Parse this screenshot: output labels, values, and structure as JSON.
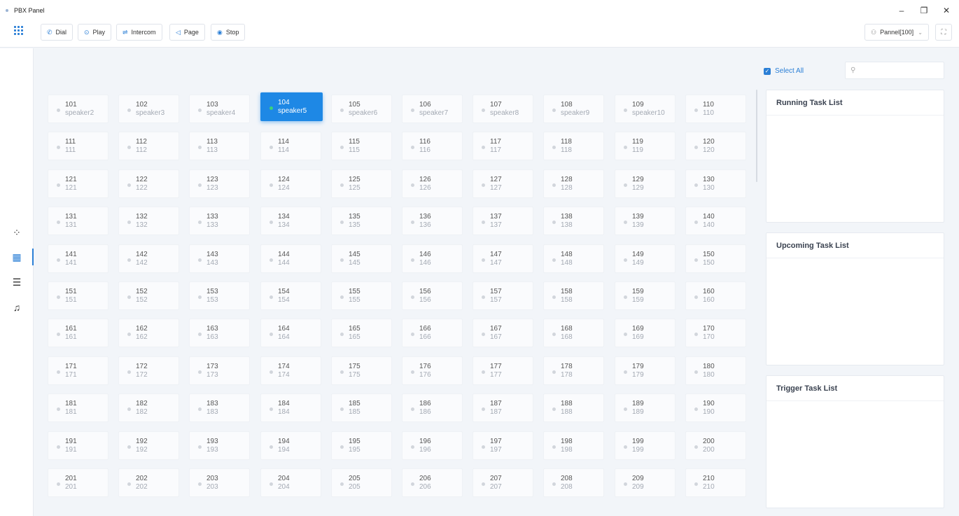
{
  "app": {
    "title": "PBX Panel"
  },
  "window": {
    "minimize": "–",
    "restore": "❐",
    "close": "✕"
  },
  "toolbar": {
    "buttons": [
      {
        "label": "Dial",
        "icon": "phone-icon",
        "glyph": "✆"
      },
      {
        "label": "Play",
        "icon": "play-icon",
        "glyph": "⊙"
      },
      {
        "label": "Intercom",
        "icon": "intercom-icon",
        "glyph": "⇌"
      },
      {
        "label": "Page",
        "icon": "megaphone-icon",
        "glyph": "◁"
      },
      {
        "label": "Stop",
        "icon": "stop-icon",
        "glyph": "◉"
      }
    ],
    "user": "Pannel[100]"
  },
  "sidenav": [
    {
      "name": "dashboard",
      "icon": "apps-grid-icon",
      "glyph": "⁘"
    },
    {
      "name": "panel",
      "icon": "panel-icon",
      "glyph": "▦",
      "active": true
    },
    {
      "name": "list",
      "icon": "list-icon",
      "glyph": "☰"
    },
    {
      "name": "music",
      "icon": "music-icon",
      "glyph": "♫"
    }
  ],
  "right": {
    "select_all": "Select All",
    "search_placeholder": "",
    "panels": [
      "Running Task List",
      "Upcoming Task List",
      "Trigger Task List"
    ]
  },
  "devices": [
    {
      "n": "101",
      "s": "speaker2"
    },
    {
      "n": "102",
      "s": "speaker3"
    },
    {
      "n": "103",
      "s": "speaker4"
    },
    {
      "n": "104",
      "s": "speaker5",
      "active": true
    },
    {
      "n": "105",
      "s": "speaker6"
    },
    {
      "n": "106",
      "s": "speaker7"
    },
    {
      "n": "107",
      "s": "speaker8"
    },
    {
      "n": "108",
      "s": "speaker9"
    },
    {
      "n": "109",
      "s": "speaker10"
    },
    {
      "n": "110",
      "s": "110"
    },
    {
      "n": "111",
      "s": "111"
    },
    {
      "n": "112",
      "s": "112"
    },
    {
      "n": "113",
      "s": "113"
    },
    {
      "n": "114",
      "s": "114"
    },
    {
      "n": "115",
      "s": "115"
    },
    {
      "n": "116",
      "s": "116"
    },
    {
      "n": "117",
      "s": "117"
    },
    {
      "n": "118",
      "s": "118"
    },
    {
      "n": "119",
      "s": "119"
    },
    {
      "n": "120",
      "s": "120"
    },
    {
      "n": "121",
      "s": "121"
    },
    {
      "n": "122",
      "s": "122"
    },
    {
      "n": "123",
      "s": "123"
    },
    {
      "n": "124",
      "s": "124"
    },
    {
      "n": "125",
      "s": "125"
    },
    {
      "n": "126",
      "s": "126"
    },
    {
      "n": "127",
      "s": "127"
    },
    {
      "n": "128",
      "s": "128"
    },
    {
      "n": "129",
      "s": "129"
    },
    {
      "n": "130",
      "s": "130"
    },
    {
      "n": "131",
      "s": "131"
    },
    {
      "n": "132",
      "s": "132"
    },
    {
      "n": "133",
      "s": "133"
    },
    {
      "n": "134",
      "s": "134"
    },
    {
      "n": "135",
      "s": "135"
    },
    {
      "n": "136",
      "s": "136"
    },
    {
      "n": "137",
      "s": "137"
    },
    {
      "n": "138",
      "s": "138"
    },
    {
      "n": "139",
      "s": "139"
    },
    {
      "n": "140",
      "s": "140"
    },
    {
      "n": "141",
      "s": "141"
    },
    {
      "n": "142",
      "s": "142"
    },
    {
      "n": "143",
      "s": "143"
    },
    {
      "n": "144",
      "s": "144"
    },
    {
      "n": "145",
      "s": "145"
    },
    {
      "n": "146",
      "s": "146"
    },
    {
      "n": "147",
      "s": "147"
    },
    {
      "n": "148",
      "s": "148"
    },
    {
      "n": "149",
      "s": "149"
    },
    {
      "n": "150",
      "s": "150"
    },
    {
      "n": "151",
      "s": "151"
    },
    {
      "n": "152",
      "s": "152"
    },
    {
      "n": "153",
      "s": "153"
    },
    {
      "n": "154",
      "s": "154"
    },
    {
      "n": "155",
      "s": "155"
    },
    {
      "n": "156",
      "s": "156"
    },
    {
      "n": "157",
      "s": "157"
    },
    {
      "n": "158",
      "s": "158"
    },
    {
      "n": "159",
      "s": "159"
    },
    {
      "n": "160",
      "s": "160"
    },
    {
      "n": "161",
      "s": "161"
    },
    {
      "n": "162",
      "s": "162"
    },
    {
      "n": "163",
      "s": "163"
    },
    {
      "n": "164",
      "s": "164"
    },
    {
      "n": "165",
      "s": "165"
    },
    {
      "n": "166",
      "s": "166"
    },
    {
      "n": "167",
      "s": "167"
    },
    {
      "n": "168",
      "s": "168"
    },
    {
      "n": "169",
      "s": "169"
    },
    {
      "n": "170",
      "s": "170"
    },
    {
      "n": "171",
      "s": "171"
    },
    {
      "n": "172",
      "s": "172"
    },
    {
      "n": "173",
      "s": "173"
    },
    {
      "n": "174",
      "s": "174"
    },
    {
      "n": "175",
      "s": "175"
    },
    {
      "n": "176",
      "s": "176"
    },
    {
      "n": "177",
      "s": "177"
    },
    {
      "n": "178",
      "s": "178"
    },
    {
      "n": "179",
      "s": "179"
    },
    {
      "n": "180",
      "s": "180"
    },
    {
      "n": "181",
      "s": "181"
    },
    {
      "n": "182",
      "s": "182"
    },
    {
      "n": "183",
      "s": "183"
    },
    {
      "n": "184",
      "s": "184"
    },
    {
      "n": "185",
      "s": "185"
    },
    {
      "n": "186",
      "s": "186"
    },
    {
      "n": "187",
      "s": "187"
    },
    {
      "n": "188",
      "s": "188"
    },
    {
      "n": "189",
      "s": "189"
    },
    {
      "n": "190",
      "s": "190"
    },
    {
      "n": "191",
      "s": "191"
    },
    {
      "n": "192",
      "s": "192"
    },
    {
      "n": "193",
      "s": "193"
    },
    {
      "n": "194",
      "s": "194"
    },
    {
      "n": "195",
      "s": "195"
    },
    {
      "n": "196",
      "s": "196"
    },
    {
      "n": "197",
      "s": "197"
    },
    {
      "n": "198",
      "s": "198"
    },
    {
      "n": "199",
      "s": "199"
    },
    {
      "n": "200",
      "s": "200"
    },
    {
      "n": "201",
      "s": "201"
    },
    {
      "n": "202",
      "s": "202"
    },
    {
      "n": "203",
      "s": "203"
    },
    {
      "n": "204",
      "s": "204"
    },
    {
      "n": "205",
      "s": "205"
    },
    {
      "n": "206",
      "s": "206"
    },
    {
      "n": "207",
      "s": "207"
    },
    {
      "n": "208",
      "s": "208"
    },
    {
      "n": "209",
      "s": "209"
    },
    {
      "n": "210",
      "s": "210"
    }
  ],
  "colors": {
    "accent": "#1e88e5",
    "online": "#3ad37a",
    "offline": "#d2d6dc"
  }
}
